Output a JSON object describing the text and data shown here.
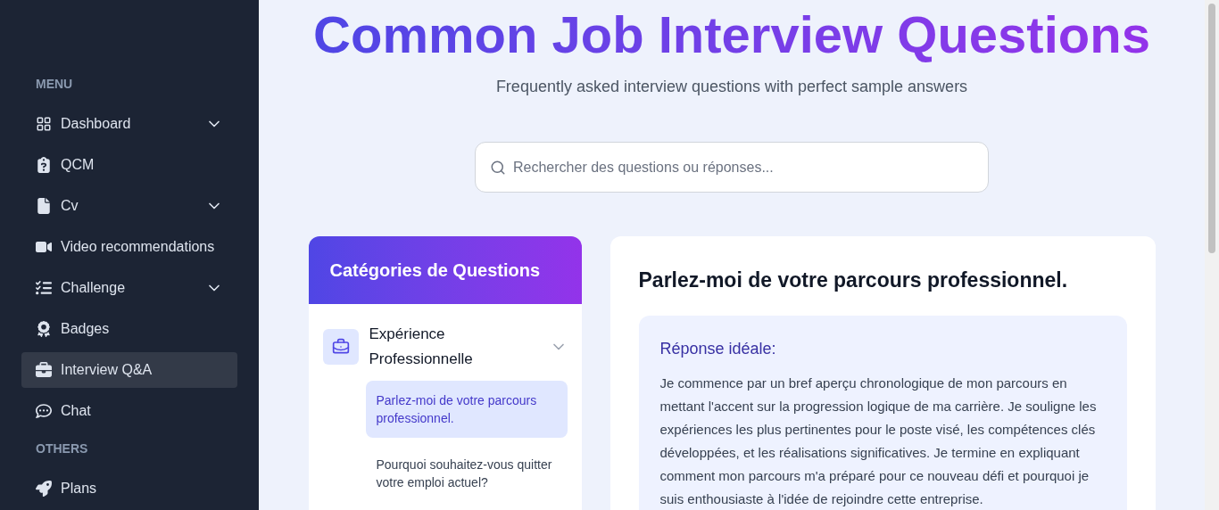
{
  "sidebar": {
    "sections": [
      {
        "heading": "MENU",
        "items": [
          {
            "label": "Dashboard",
            "expandable": true,
            "selected": false
          },
          {
            "label": "QCM",
            "expandable": false,
            "selected": false
          },
          {
            "label": "Cv",
            "expandable": true,
            "selected": false
          },
          {
            "label": "Video recommendations",
            "expandable": false,
            "selected": false
          },
          {
            "label": "Challenge",
            "expandable": true,
            "selected": false
          },
          {
            "label": "Badges",
            "expandable": false,
            "selected": false
          },
          {
            "label": "Interview Q&A",
            "expandable": false,
            "selected": true
          },
          {
            "label": "Chat",
            "expandable": false,
            "selected": false
          }
        ]
      },
      {
        "heading": "OTHERS",
        "items": [
          {
            "label": "Plans",
            "expandable": false,
            "selected": false
          }
        ]
      }
    ]
  },
  "page": {
    "title": "Common Job Interview Questions",
    "subtitle": "Frequently asked interview questions with perfect sample answers"
  },
  "search": {
    "placeholder": "Rechercher des questions ou réponses..."
  },
  "categories": {
    "title": "Catégories de Questions",
    "groups": [
      {
        "label": "Expérience Professionnelle",
        "expanded": true,
        "questions": [
          {
            "text": "Parlez-moi de votre parcours professionnel.",
            "selected": true
          },
          {
            "text": "Pourquoi souhaitez-vous quitter votre emploi actuel?",
            "selected": false
          }
        ]
      }
    ]
  },
  "answer": {
    "question": "Parlez-moi de votre parcours professionnel.",
    "label": "Réponse idéale:",
    "text": "Je commence par un bref aperçu chronologique de mon parcours en mettant l'accent sur la progression logique de ma carrière. Je souligne les expériences les plus pertinentes pour le poste visé, les compétences clés développées, et les réalisations significatives. Je termine en expliquant comment mon parcours m'a préparé pour ce nouveau défi et pourquoi je suis enthousiaste à l'idée de rejoindre cette entreprise."
  }
}
